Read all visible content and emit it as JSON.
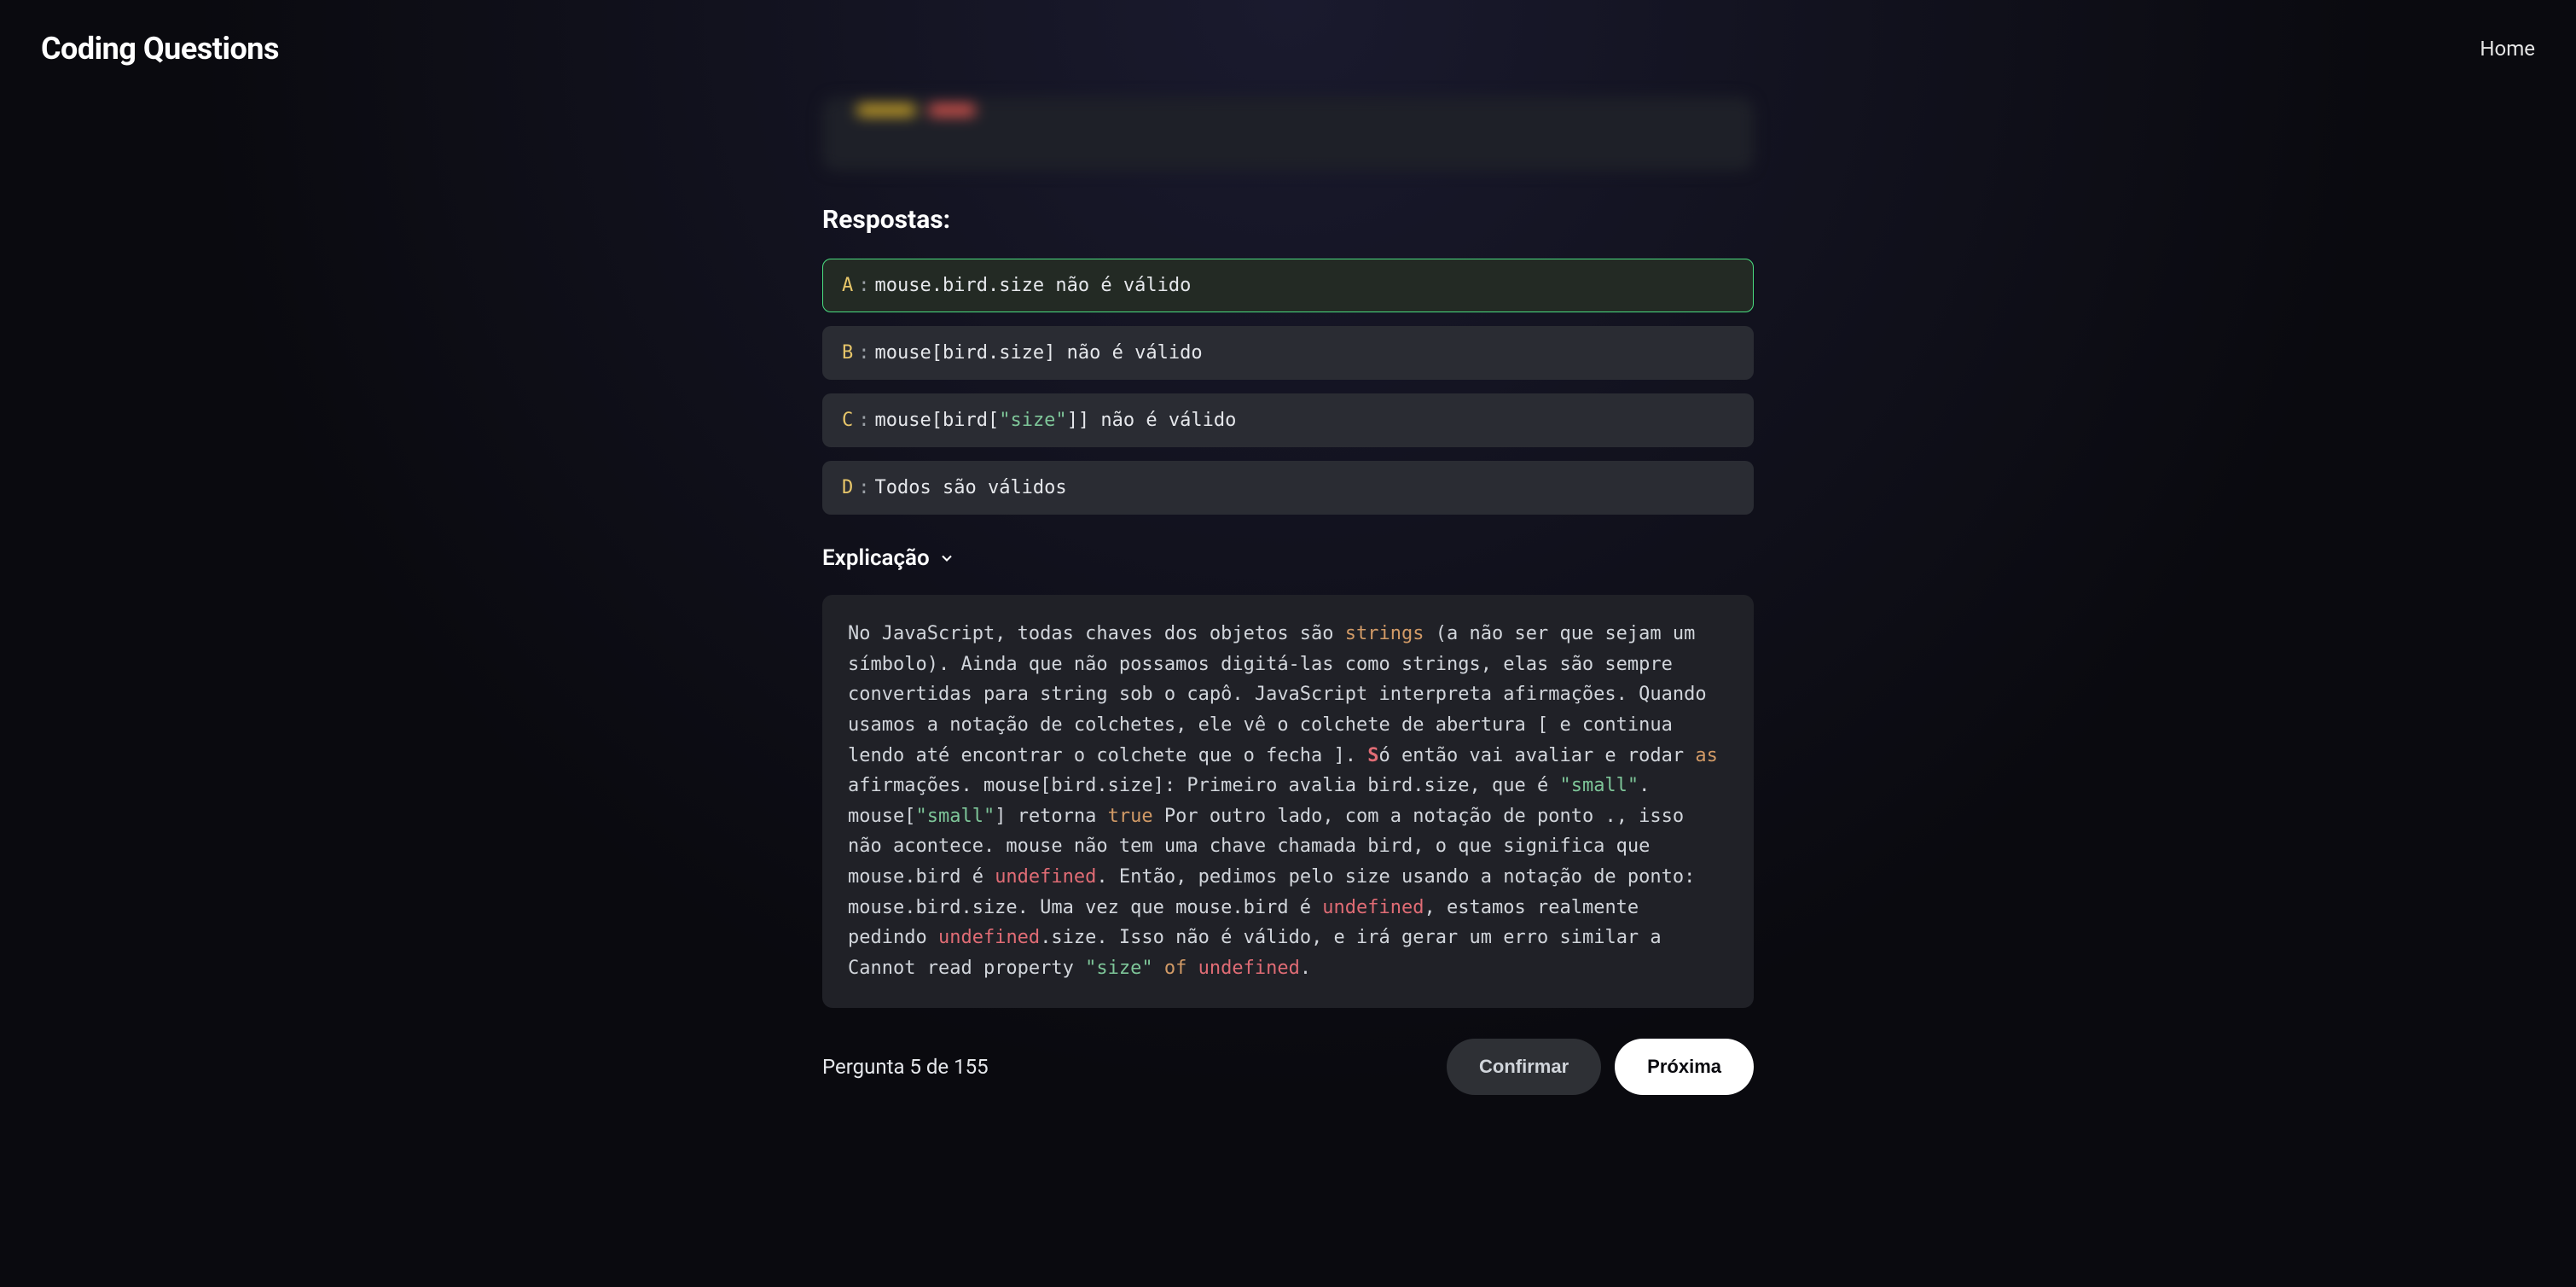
{
  "header": {
    "brand": "Coding Questions",
    "home": "Home"
  },
  "answers_title": "Respostas:",
  "choices": [
    {
      "key": "A",
      "sep": ":",
      "text_plain": "mouse.bird.size não é válido",
      "selected": true
    },
    {
      "key": "B",
      "sep": ":",
      "text_plain": "mouse[bird.size] não é válido",
      "selected": false
    },
    {
      "key": "C",
      "sep": ":",
      "pre": "mouse[bird[",
      "str": "\"size\"",
      "post": "]] não é válido",
      "selected": false,
      "has_str": true
    },
    {
      "key": "D",
      "sep": ":",
      "text_plain": "Todos são válidos",
      "selected": false
    }
  ],
  "explanation": {
    "label": "Explicação",
    "p1a": "No JavaScript, todas chaves dos objetos são ",
    "p1_strings": "strings",
    "p1b": " (a não ser que sejam um símbolo). Ainda que não possamos digitá-las como strings, elas são sempre convertidas para string sob o capô. JavaScript interpreta afirmações. Quando usamos a notação de colchetes, ele vê o colchete de abertura [ e continua lendo até encontrar o colchete que o fecha ]. ",
    "p1_so_char": "S",
    "p1c": "ó então vai avaliar e rodar ",
    "p1_as": "as",
    "p1d": " afirmações. mouse[bird.size]: Primeiro avalia bird.size, que é ",
    "p1_small1": "\"small\"",
    "p1e": ". mouse[",
    "p1_small2": "\"small\"",
    "p1f": "] retorna ",
    "p1_true": "true",
    "p1g": " Por outro lado, com a notação de ponto ., isso não acontece. mouse não tem uma chave chamada bird, o que significa que mouse.bird é ",
    "p1_undef1": "undefined",
    "p1h": ". Então, pedimos pelo size usando a notação de ponto: mouse.bird.size. Uma vez que mouse.bird é ",
    "p1_undef2": "undefined",
    "p1i": ", estamos realmente pedindo ",
    "p1_undef3": "undefined",
    "p1j": ".size. Isso não é válido, e irá gerar um erro similar a Cannot read property ",
    "p1_size": "\"size\"",
    "p1_of": " of ",
    "p1_undef4": "undefined",
    "p1k": "."
  },
  "footer": {
    "progress": "Pergunta 5 de 155",
    "confirm": "Confirmar",
    "next": "Próxima"
  }
}
